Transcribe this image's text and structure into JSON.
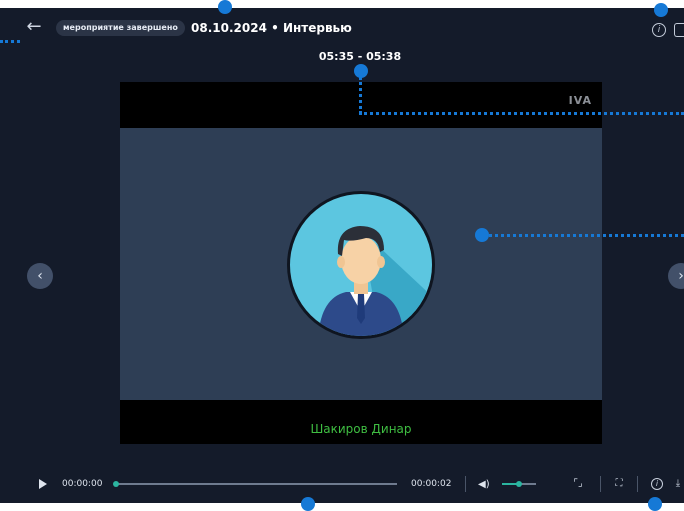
{
  "header": {
    "back_icon": "arrow-left-icon",
    "status_badge": "мероприятие завершено",
    "title": "08.10.2024 • Интервью",
    "info_icon": "info-icon"
  },
  "time_interval": "05:35 - 05:38",
  "video": {
    "logo_text": "IVA",
    "speaker_name": "Шакиров Динар",
    "avatar_icon": "user-avatar-icon"
  },
  "nav": {
    "prev_icon": "‹",
    "next_icon": "›"
  },
  "controls": {
    "play_icon": "play-icon",
    "current_time": "00:00:00",
    "total_time": "00:00:02",
    "progress_percent": 0,
    "volume_icon": "volume-icon",
    "volume_percent": 50,
    "fit_icon": "fit-screen-icon",
    "fullscreen_icon": "fullscreen-icon",
    "info_icon": "info-icon",
    "download_icon": "download-icon"
  },
  "colors": {
    "background": "#141b2a",
    "accent": "#2bb5a0",
    "speaker_name": "#3fbe42",
    "annotation": "#1679d6"
  }
}
